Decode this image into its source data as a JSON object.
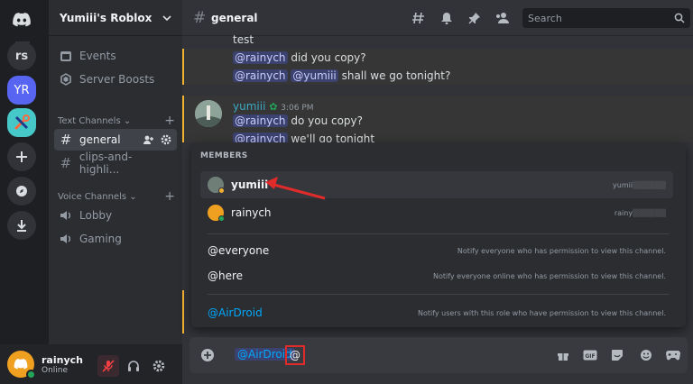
{
  "rail": {
    "servers": [
      {
        "label": "rs"
      },
      {
        "label": "YR"
      }
    ]
  },
  "sidebar": {
    "server_name": "Yumiii's Roblox",
    "items": [
      {
        "label": "Events",
        "icon": "calendar-icon"
      },
      {
        "label": "Server Boosts",
        "icon": "boost-icon"
      }
    ],
    "text_category": "Text Channels",
    "text_channels": [
      {
        "label": "general",
        "active": true
      },
      {
        "label": "clips-and-highli..."
      }
    ],
    "voice_category": "Voice Channels",
    "voice_channels": [
      {
        "label": "Lobby"
      },
      {
        "label": "Gaming"
      }
    ]
  },
  "user_panel": {
    "username": "rainych",
    "status": "Online"
  },
  "header": {
    "channel_name": "general",
    "search_placeholder": "Search"
  },
  "messages": {
    "line1": "test",
    "line2_mention": "@rainych",
    "line2_text": "did you copy?",
    "line3_mention1": "@rainych",
    "line3_mention2": "@yumiii",
    "line3_text": "shall we go tonight?",
    "author": "yumiii",
    "time": "3:06 PM",
    "line4_mention": "@rainych",
    "line4_text": "do you copy?",
    "line5_mention": "@rainych",
    "line5_text": "we'll go tonight"
  },
  "popup": {
    "header": "MEMBERS",
    "members": [
      {
        "name": "yumiii",
        "tag": "yumii"
      },
      {
        "name": "rainych",
        "tag": "rainy"
      }
    ],
    "everyone_label": "@everyone",
    "everyone_desc": "Notify everyone who has permission to view this channel.",
    "here_label": "@here",
    "here_desc": "Notify everyone online who has permission to view this channel.",
    "role_label": "@AirDroid",
    "role_desc": "Notify users with this role who have permission to view this channel."
  },
  "input": {
    "mention": "@AirDroid",
    "at": "@"
  },
  "colors": {
    "accent": "#5865f2",
    "online": "#23a55a",
    "role": "#00a8fc",
    "highlight": "#f0b232",
    "annotation": "#e02b2b"
  }
}
